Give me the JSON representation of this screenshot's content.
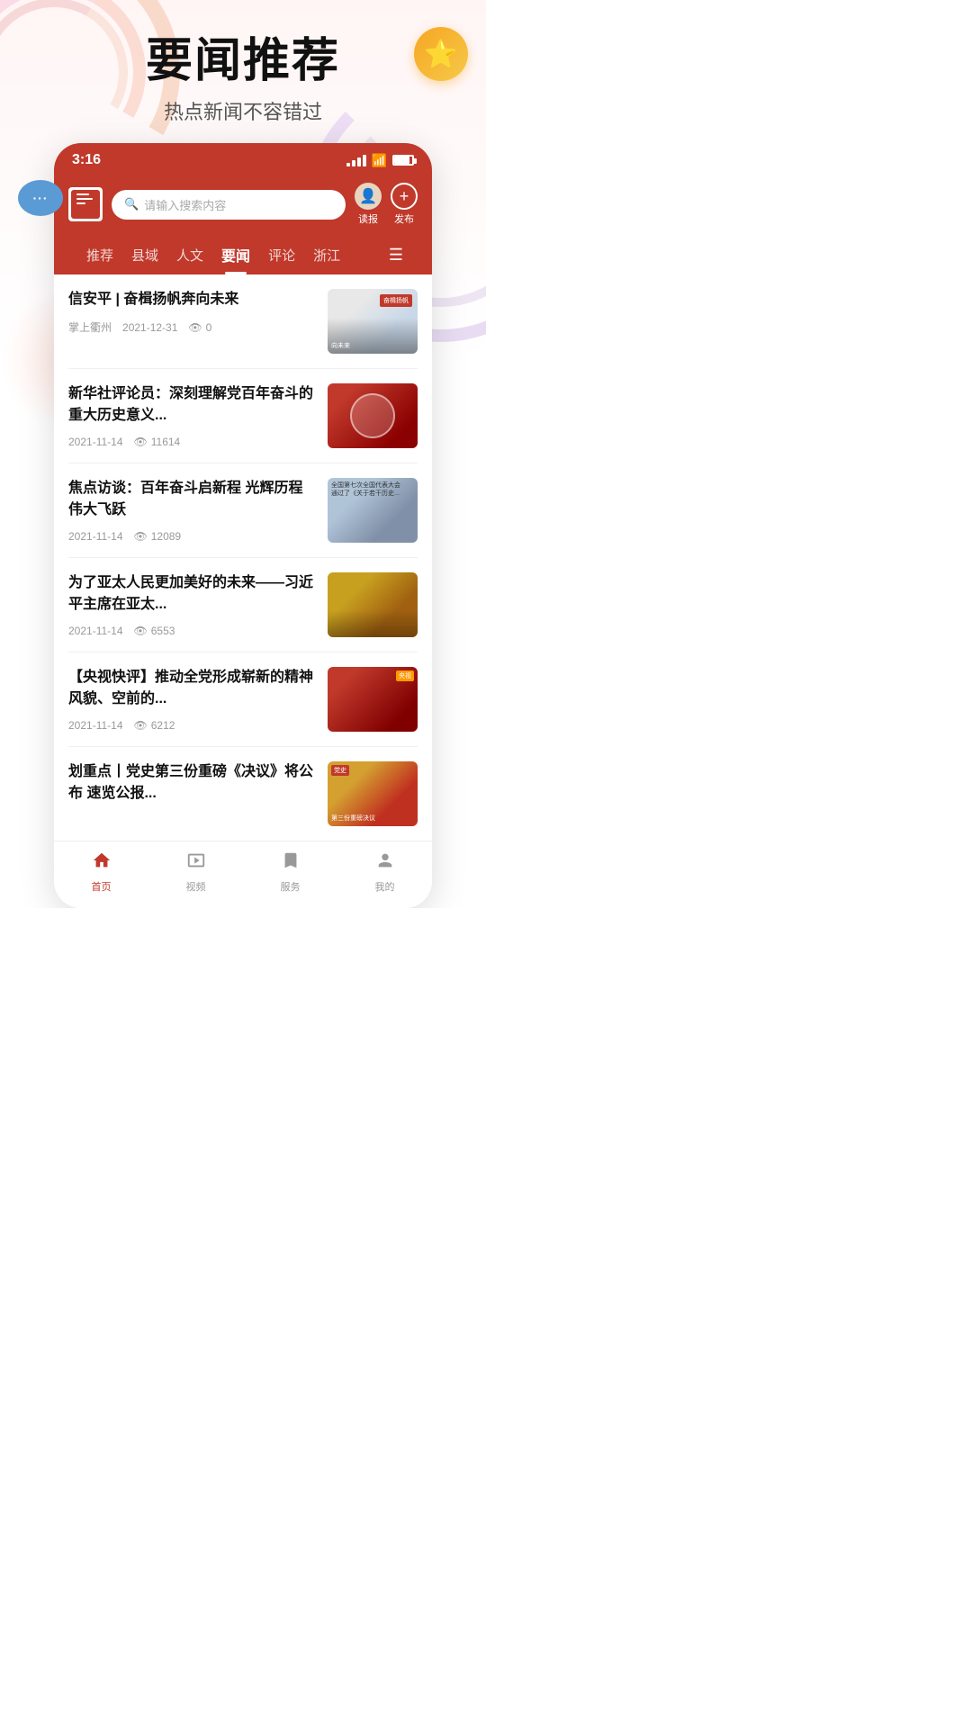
{
  "page": {
    "title": "要闻推荐",
    "subtitle": "热点新闻不容错过"
  },
  "status_bar": {
    "time": "3:16",
    "signal": "signal",
    "wifi": "wifi",
    "battery": "battery"
  },
  "header": {
    "search_placeholder": "请输入搜索内容",
    "read_label": "读报",
    "publish_label": "发布"
  },
  "nav_tabs": [
    {
      "label": "推荐",
      "active": false
    },
    {
      "label": "县域",
      "active": false
    },
    {
      "label": "人文",
      "active": false
    },
    {
      "label": "要闻",
      "active": true
    },
    {
      "label": "评论",
      "active": false
    },
    {
      "label": "浙江",
      "active": false
    }
  ],
  "news_items": [
    {
      "title": "信安平 | 奋楫扬帆奔向未来",
      "source": "掌上衢州",
      "date": "2021-12-31",
      "views": "0",
      "thumb_type": "thumb-1"
    },
    {
      "title": "新华社评论员：深刻理解党百年奋斗的重大历史意义...",
      "source": "",
      "date": "2021-11-14",
      "views": "11614",
      "thumb_type": "thumb-2"
    },
    {
      "title": "焦点访谈：百年奋斗启新程 光辉历程 伟大飞跃",
      "source": "",
      "date": "2021-11-14",
      "views": "12089",
      "thumb_type": "thumb-3"
    },
    {
      "title": "为了亚太人民更加美好的未来——习近平主席在亚太...",
      "source": "",
      "date": "2021-11-14",
      "views": "6553",
      "thumb_type": "thumb-4"
    },
    {
      "title": "【央视快评】推动全党形成崭新的精神风貌、空前的...",
      "source": "",
      "date": "2021-11-14",
      "views": "6212",
      "thumb_type": "thumb-5"
    },
    {
      "title": "划重点丨党史第三份重磅《决议》将公布 速览公报...",
      "source": "",
      "date": "",
      "views": "",
      "thumb_type": "thumb-6"
    }
  ],
  "bottom_nav": [
    {
      "label": "首页",
      "icon": "🏠",
      "active": true
    },
    {
      "label": "视频",
      "icon": "📺",
      "active": false
    },
    {
      "label": "服务",
      "icon": "🔖",
      "active": false
    },
    {
      "label": "我的",
      "icon": "👤",
      "active": false
    }
  ]
}
